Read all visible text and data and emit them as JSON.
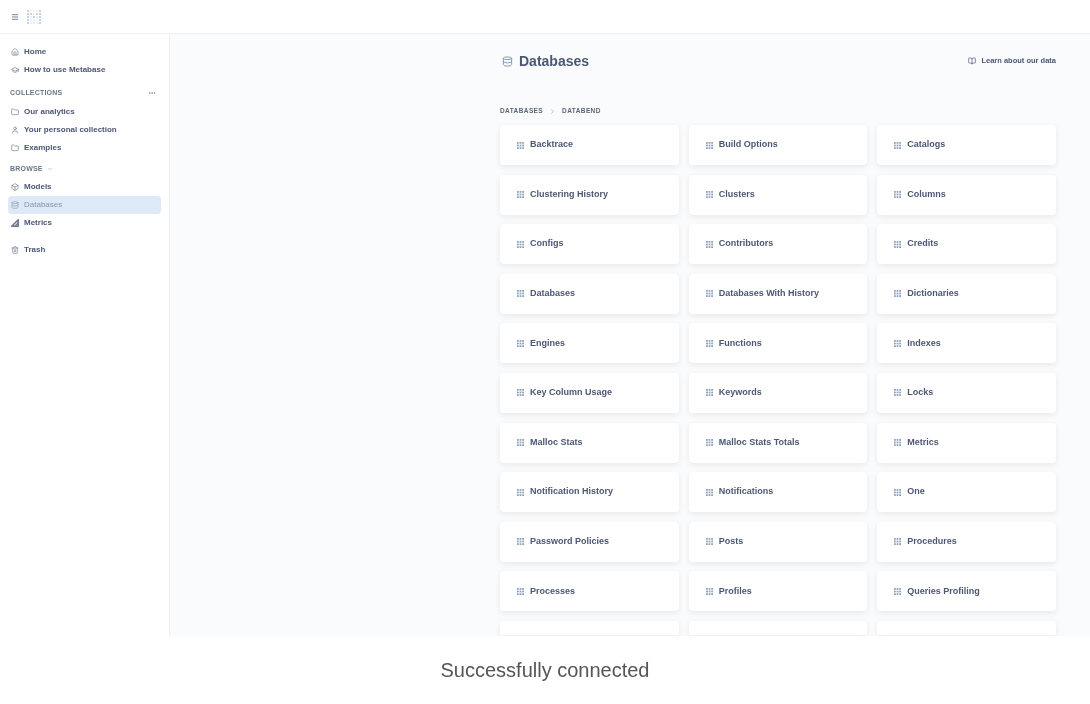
{
  "sidebar": {
    "items": [
      {
        "label": "Home",
        "selected": false
      },
      {
        "label": "How to use Metabase",
        "selected": false
      }
    ],
    "sections": [
      {
        "kind": "with_menu",
        "title": "COLLECTIONS",
        "items": [
          {
            "label": "Our analytics",
            "selected": false
          },
          {
            "label": "Your personal collection",
            "selected": false
          },
          {
            "label": "Examples",
            "selected": false
          }
        ]
      },
      {
        "kind": "collapsible",
        "title": "BROWSE",
        "expanded": true,
        "items": [
          {
            "label": "Models",
            "selected": false
          },
          {
            "label": "Databases",
            "selected": true
          },
          {
            "label": "Metrics",
            "selected": false
          }
        ]
      }
    ],
    "bottom_items": [
      {
        "label": "Trash",
        "selected": false
      }
    ]
  },
  "page": {
    "title": "Databases",
    "link": "Learn about our data",
    "breadcrumb": [
      {
        "label": "DATABASES"
      },
      {
        "label": "DATABEND"
      }
    ],
    "tables": [
      "Backtrace",
      "Build Options",
      "Catalogs",
      "Clustering History",
      "Clusters",
      "Columns",
      "Configs",
      "Contributors",
      "Credits",
      "Databases",
      "Databases With History",
      "Dictionaries",
      "Engines",
      "Functions",
      "Indexes",
      "Key Column Usage",
      "Keywords",
      "Locks",
      "Malloc Stats",
      "Malloc Stats Totals",
      "Metrics",
      "Notification History",
      "Notifications",
      "One",
      "Password Policies",
      "Posts",
      "Procedures",
      "Processes",
      "Profiles",
      "Queries Profiling"
    ]
  },
  "caption": "Successfully connected"
}
